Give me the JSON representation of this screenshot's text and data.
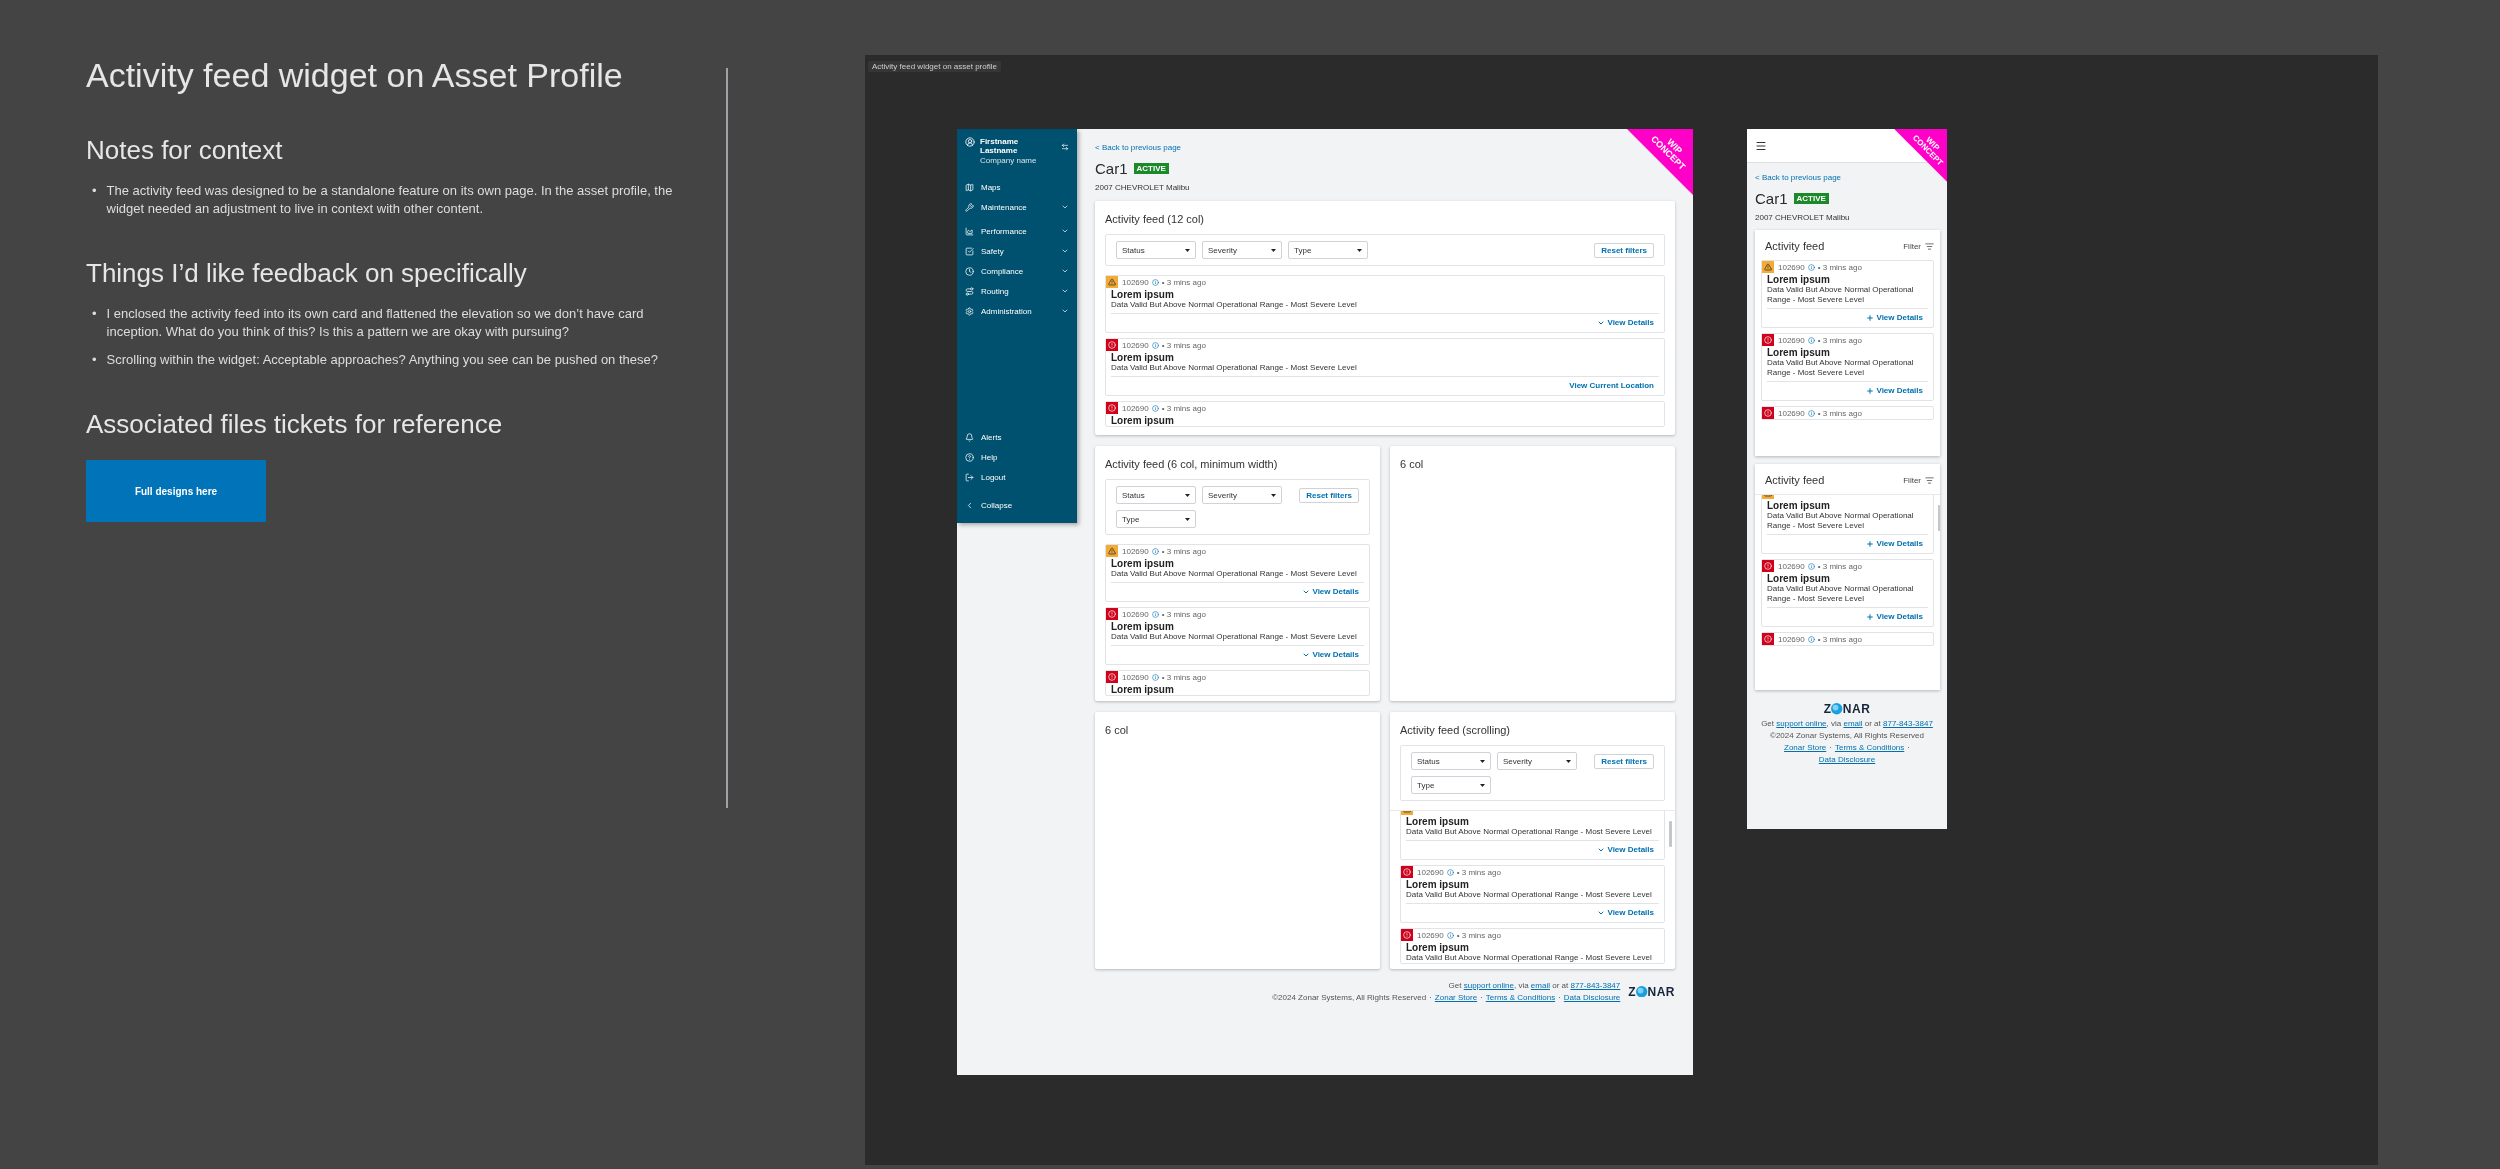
{
  "notes": {
    "title": "Activity feed widget on Asset Profile",
    "sections": [
      {
        "heading": "Notes for context",
        "bullets": [
          {
            "marker": "•",
            "text": "The activity feed was designed to be a standalone feature on its own page. In the asset profile, the widget needed an adjustment to live in context with other content."
          }
        ]
      },
      {
        "heading": "Things I’d like feedback on specifically",
        "bullets": [
          {
            "marker": "•",
            "text": "I enclosed the activity feed into its own card and flattened the elevation so we don’t have card inception. What do you think of this? Is this a pattern we are okay with pursuing?"
          },
          {
            "marker": "•",
            "text": "Scrolling within the widget: Acceptable approaches? Anything you see can be pushed on these?"
          }
        ]
      },
      {
        "heading": "Associated files tickets for reference",
        "button": "Full designs here"
      }
    ]
  },
  "frame": {
    "label": "Activity feed widget on asset profile"
  },
  "desktop": {
    "ribbon": "WIP CONCEPT",
    "sidebar": {
      "user_name": "Firstname Lastname",
      "company": "Company name",
      "nav": [
        {
          "label": "Maps",
          "expandable": false
        },
        {
          "label": "Maintenance",
          "expandable": true
        },
        {
          "label": "Performance",
          "expandable": true
        },
        {
          "label": "Safety",
          "expandable": true
        },
        {
          "label": "Compliance",
          "expandable": true
        },
        {
          "label": "Routing",
          "expandable": true
        },
        {
          "label": "Administration",
          "expandable": true
        }
      ],
      "bottom": [
        {
          "label": "Alerts"
        },
        {
          "label": "Help"
        },
        {
          "label": "Logout"
        }
      ],
      "collapse": "Collapse"
    },
    "back_link": "< Back to previous page",
    "title": "Car1",
    "status": "ACTIVE",
    "subtitle": "2007 CHEVROLET Malibu",
    "cards": [
      {
        "kind": "wide_feed",
        "title": "Activity feed (12 col)",
        "scrolled": false,
        "filters": [
          "Status",
          "Severity",
          "Type"
        ],
        "reset": "Reset filters",
        "items": [
          {
            "kind": "warning",
            "id": "102690",
            "time": "• 3 mins ago",
            "title": "Lorem ipsum",
            "description": "Data Valid But Above Normal Operational Range - Most Severe Level",
            "action": {
              "kind": "expand",
              "label": "View Details"
            }
          },
          {
            "kind": "critical",
            "id": "102690",
            "time": "• 3 mins ago",
            "title": "Lorem ipsum",
            "description": "Data Valid But Above Normal Operational Range - Most Severe Level",
            "action": {
              "kind": "link",
              "label": "View Current Location"
            }
          },
          {
            "kind": "critical",
            "id": "102690",
            "time": "• 3 mins ago",
            "title": "Lorem ipsum"
          }
        ]
      },
      {
        "kind": "feed",
        "title": "Activity feed (6 col, minimum width)",
        "scrolled": false,
        "filters": [
          "Status",
          "Severity",
          "Type"
        ],
        "reset": "Reset filters",
        "items": [
          {
            "kind": "warning",
            "id": "102690",
            "time": "• 3 mins ago",
            "title": "Lorem ipsum",
            "description": "Data Valid But Above Normal Operational Range - Most Severe Level",
            "action": {
              "kind": "expand",
              "label": "View Details"
            }
          },
          {
            "kind": "critical",
            "id": "102690",
            "time": "• 3 mins ago",
            "title": "Lorem ipsum",
            "description": "Data Valid But Above Normal Operational Range - Most Severe Level",
            "action": {
              "kind": "expand",
              "label": "View Details"
            }
          },
          {
            "kind": "critical",
            "id": "102690",
            "time": "• 3 mins ago",
            "title": "Lorem ipsum"
          }
        ]
      },
      {
        "kind": "empty",
        "title": "6 col"
      },
      {
        "kind": "empty",
        "title": "6 col"
      },
      {
        "kind": "feed",
        "title": "Activity feed (scrolling)",
        "scrolled": true,
        "filters": [
          "Status",
          "Severity",
          "Type"
        ],
        "reset": "Reset filters",
        "items": [
          {
            "kind": "warning",
            "title": "Lorem ipsum",
            "description": "Data Valid But Above Normal Operational Range - Most Severe Level",
            "action": {
              "kind": "expand",
              "label": "View Details"
            }
          },
          {
            "kind": "critical",
            "id": "102690",
            "time": "• 3 mins ago",
            "title": "Lorem ipsum",
            "description": "Data Valid But Above Normal Operational Range - Most Severe Level",
            "action": {
              "kind": "expand",
              "label": "View Details"
            }
          },
          {
            "kind": "critical",
            "id": "102690",
            "time": "• 3 mins ago",
            "title": "Lorem ipsum",
            "description": "Data Valid But Above Normal Operational Range - Most Severe Level"
          }
        ]
      }
    ],
    "footer": {
      "support": [
        {
          "text": "Get "
        },
        {
          "link": "support online"
        },
        {
          "text": ", via "
        },
        {
          "link": "email"
        },
        {
          "text": " or at "
        },
        {
          "link": "877-843-3847"
        }
      ],
      "copyright": "©2024 Zonar Systems, All Rights Reserved",
      "separator": "·",
      "links": [
        "Zonar Store",
        "Terms & Conditions",
        "Data Disclosure"
      ],
      "logo": {
        "before": "Z",
        "after": "NAR"
      }
    }
  },
  "mobile": {
    "ribbon": "WIP CONCEPT",
    "back_link": "< Back to previous page",
    "title": "Car1",
    "status": "ACTIVE",
    "subtitle": "2007 CHEVROLET Malibu",
    "feeds": [
      {
        "title": "Activity feed",
        "filter": "Filter",
        "scrolled": false,
        "items": [
          {
            "kind": "warning",
            "id": "102690",
            "time": "• 3 mins ago",
            "title": "Lorem ipsum",
            "description": "Data Valid But Above Normal Operational Range - Most Severe Level",
            "action": {
              "kind": "add",
              "label": "View Details"
            }
          },
          {
            "kind": "critical",
            "id": "102690",
            "time": "• 3 mins ago",
            "title": "Lorem ipsum",
            "description": "Data Valid But Above Normal Operational Range - Most Severe Level",
            "action": {
              "kind": "add",
              "label": "View Details"
            }
          },
          {
            "kind": "critical",
            "id": "102690",
            "time": "• 3 mins ago"
          }
        ]
      },
      {
        "title": "Activity feed",
        "filter": "Filter",
        "scrolled": true,
        "items": [
          {
            "kind": "warning",
            "title": "Lorem ipsum",
            "description": "Data Valid But Above Normal Operational Range - Most Severe Level",
            "action": {
              "kind": "add",
              "label": "View Details"
            }
          },
          {
            "kind": "critical",
            "id": "102690",
            "time": "• 3 mins ago",
            "title": "Lorem ipsum",
            "description": "Data Valid But Above Normal Operational Range - Most Severe Level",
            "action": {
              "kind": "add",
              "label": "View Details"
            }
          },
          {
            "kind": "critical",
            "id": "102690",
            "time": "• 3 mins ago"
          }
        ]
      }
    ],
    "footer": {
      "logo": {
        "before": "Z",
        "after": "NAR"
      },
      "support": [
        {
          "text": "Get "
        },
        {
          "link": "support online"
        },
        {
          "text": ", via "
        },
        {
          "link": "email"
        },
        {
          "text": " or at "
        },
        {
          "link": "877-843-3847"
        }
      ],
      "copyright": "©2024 Zonar Systems, All Rights Reserved",
      "separator": "·",
      "links": [
        "Zonar Store",
        "Terms & Conditions",
        "Data Disclosure"
      ]
    }
  }
}
